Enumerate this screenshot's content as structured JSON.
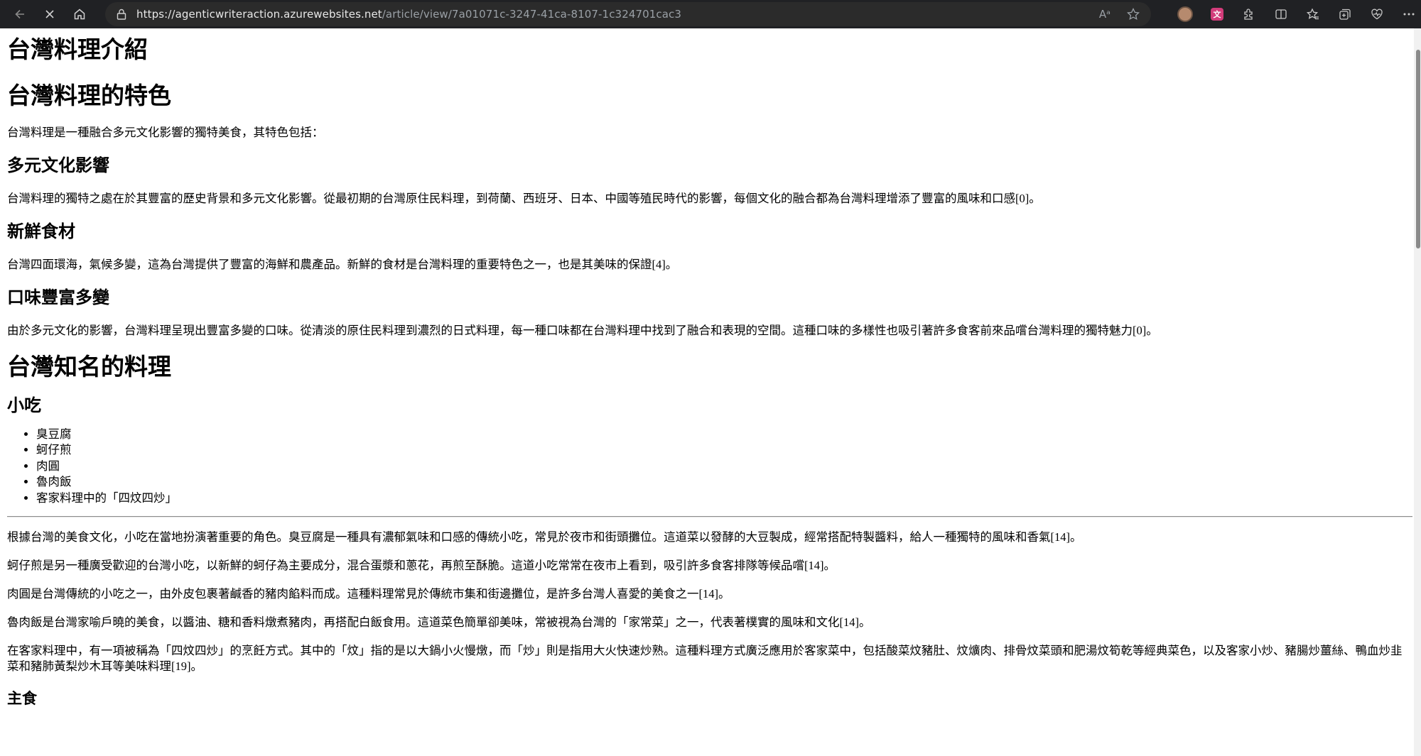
{
  "browser": {
    "url_host": "https://agenticwriteraction.azurewebsites.net",
    "url_path": "/article/view/7a01071c-3247-41ca-8107-1c324701cac3",
    "read_aloud_label": "Aᵃ",
    "icons": [
      "back-icon",
      "close-icon",
      "home-icon",
      "lock-icon",
      "read-aloud-icon",
      "favorite-star-icon",
      "profile-avatar-icon",
      "extension-icon",
      "extensions-puzzle-icon",
      "split-screen-icon",
      "favorites-icon",
      "collections-icon",
      "browser-essentials-icon",
      "more-menu-icon"
    ]
  },
  "article": {
    "title": "台灣料理介紹",
    "section1": {
      "heading": "台灣料理的特色",
      "intro": "台灣料理是一種融合多元文化影響的獨特美食，其特色包括：",
      "sub1": {
        "heading": "多元文化影響",
        "text": "台灣料理的獨特之處在於其豐富的歷史背景和多元文化影響。從最初期的台灣原住民料理，到荷蘭、西班牙、日本、中國等殖民時代的影響，每個文化的融合都為台灣料理增添了豐富的風味和口感[0]。"
      },
      "sub2": {
        "heading": "新鮮食材",
        "text": "台灣四面環海，氣候多變，這為台灣提供了豐富的海鮮和農產品。新鮮的食材是台灣料理的重要特色之一，也是其美味的保證[4]。"
      },
      "sub3": {
        "heading": "口味豐富多變",
        "text": "由於多元文化的影響，台灣料理呈現出豐富多變的口味。從清淡的原住民料理到濃烈的日式料理，每一種口味都在台灣料理中找到了融合和表現的空間。這種口味的多樣性也吸引著許多食客前來品嚐台灣料理的獨特魅力[0]。"
      }
    },
    "section2": {
      "heading": "台灣知名的料理",
      "snacks": {
        "heading": "小吃",
        "items": [
          "臭豆腐",
          "蚵仔煎",
          "肉圓",
          "魯肉飯",
          "客家料理中的「四炆四炒」"
        ],
        "paragraphs": [
          "根據台灣的美食文化，小吃在當地扮演著重要的角色。臭豆腐是一種具有濃郁氣味和口感的傳統小吃，常見於夜市和街頭攤位。這道菜以發酵的大豆製成，經常搭配特製醬料，給人一種獨特的風味和香氣[14]。",
          "蚵仔煎是另一種廣受歡迎的台灣小吃，以新鮮的蚵仔為主要成分，混合蛋漿和蔥花，再煎至酥脆。這道小吃常常在夜市上看到，吸引許多食客排隊等候品嚐[14]。",
          "肉圓是台灣傳統的小吃之一，由外皮包裹著鹹香的豬肉餡料而成。這種料理常見於傳統市集和街邊攤位，是許多台灣人喜愛的美食之一[14]。",
          "魯肉飯是台灣家喻戶曉的美食，以醬油、糖和香料燉煮豬肉，再搭配白飯食用。這道菜色簡單卻美味，常被視為台灣的「家常菜」之一，代表著樸實的風味和文化[14]。",
          "在客家料理中，有一項被稱為「四炆四炒」的烹飪方式。其中的「炆」指的是以大鍋小火慢燉，而「炒」則是指用大火快速炒熟。這種料理方式廣泛應用於客家菜中，包括酸菜炆豬肚、炆爌肉、排骨炆菜頭和肥湯炆筍乾等經典菜色，以及客家小炒、豬腸炒薑絲、鴨血炒韭菜和豬肺黃梨炒木耳等美味料理[19]。"
        ]
      },
      "staple": {
        "heading": "主食"
      }
    }
  }
}
